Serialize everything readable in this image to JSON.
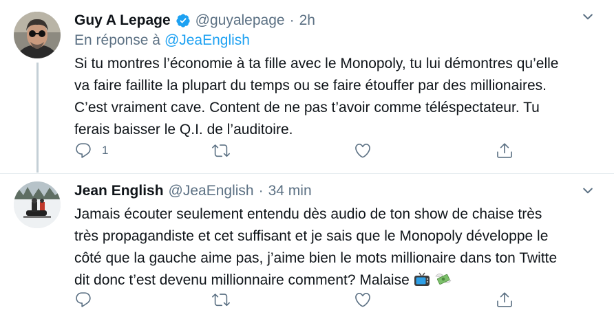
{
  "tweets": [
    {
      "author_name": "Guy A Lepage",
      "handle": "@guyalepage",
      "separator": "·",
      "time": "2h",
      "reply_prefix": "En réponse à",
      "reply_to": "@JeaEnglish",
      "text_lines": [
        "Si tu montres l’économie à ta fille avec le Monopoly, tu lui démontres qu’elle",
        "va faire faillite la plupart du temps ou se faire étouffer par des millionaires.",
        "C’est vraiment cave. Content de ne pas t’avoir comme téléspectateur. Tu",
        "ferais baisser le Q.I. de l’auditoire."
      ],
      "reply_count": "1",
      "verified": true
    },
    {
      "author_name": "Jean English",
      "handle": "@JeaEnglish",
      "separator": "·",
      "time": "34 min",
      "text_lines": [
        "Jamais écouter seulement entendu dès audio de ton show de chaise très",
        "très propagandiste et cet suffisant et je sais que le Monopoly développe le",
        "côté que la gauche aime pas, j’aime bien le mots millionaire dans ton Twitte",
        "dit donc t’est  devenu millionnaire comment? Malaise"
      ],
      "emojis": [
        "television-emoji",
        "money-with-wings-emoji"
      ],
      "reply_count": ""
    }
  ],
  "colors": {
    "primary_text": "#0f1419",
    "secondary_text": "#5b7083",
    "accent_blue": "#1da1f2",
    "thread_line": "#c4cfd6"
  }
}
